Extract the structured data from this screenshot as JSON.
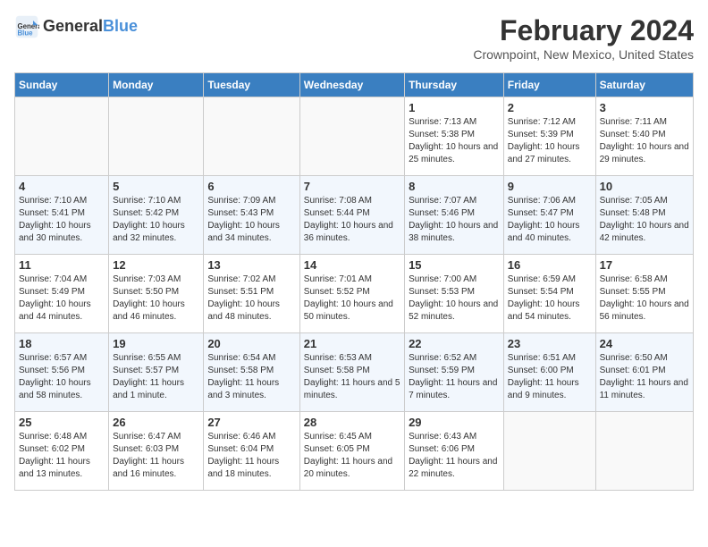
{
  "logo": {
    "line1": "General",
    "line2": "Blue"
  },
  "title": "February 2024",
  "subtitle": "Crownpoint, New Mexico, United States",
  "days_header": [
    "Sunday",
    "Monday",
    "Tuesday",
    "Wednesday",
    "Thursday",
    "Friday",
    "Saturday"
  ],
  "weeks": [
    [
      {
        "num": "",
        "sunrise": "",
        "sunset": "",
        "daylight": ""
      },
      {
        "num": "",
        "sunrise": "",
        "sunset": "",
        "daylight": ""
      },
      {
        "num": "",
        "sunrise": "",
        "sunset": "",
        "daylight": ""
      },
      {
        "num": "",
        "sunrise": "",
        "sunset": "",
        "daylight": ""
      },
      {
        "num": "1",
        "sunrise": "Sunrise: 7:13 AM",
        "sunset": "Sunset: 5:38 PM",
        "daylight": "Daylight: 10 hours and 25 minutes."
      },
      {
        "num": "2",
        "sunrise": "Sunrise: 7:12 AM",
        "sunset": "Sunset: 5:39 PM",
        "daylight": "Daylight: 10 hours and 27 minutes."
      },
      {
        "num": "3",
        "sunrise": "Sunrise: 7:11 AM",
        "sunset": "Sunset: 5:40 PM",
        "daylight": "Daylight: 10 hours and 29 minutes."
      }
    ],
    [
      {
        "num": "4",
        "sunrise": "Sunrise: 7:10 AM",
        "sunset": "Sunset: 5:41 PM",
        "daylight": "Daylight: 10 hours and 30 minutes."
      },
      {
        "num": "5",
        "sunrise": "Sunrise: 7:10 AM",
        "sunset": "Sunset: 5:42 PM",
        "daylight": "Daylight: 10 hours and 32 minutes."
      },
      {
        "num": "6",
        "sunrise": "Sunrise: 7:09 AM",
        "sunset": "Sunset: 5:43 PM",
        "daylight": "Daylight: 10 hours and 34 minutes."
      },
      {
        "num": "7",
        "sunrise": "Sunrise: 7:08 AM",
        "sunset": "Sunset: 5:44 PM",
        "daylight": "Daylight: 10 hours and 36 minutes."
      },
      {
        "num": "8",
        "sunrise": "Sunrise: 7:07 AM",
        "sunset": "Sunset: 5:46 PM",
        "daylight": "Daylight: 10 hours and 38 minutes."
      },
      {
        "num": "9",
        "sunrise": "Sunrise: 7:06 AM",
        "sunset": "Sunset: 5:47 PM",
        "daylight": "Daylight: 10 hours and 40 minutes."
      },
      {
        "num": "10",
        "sunrise": "Sunrise: 7:05 AM",
        "sunset": "Sunset: 5:48 PM",
        "daylight": "Daylight: 10 hours and 42 minutes."
      }
    ],
    [
      {
        "num": "11",
        "sunrise": "Sunrise: 7:04 AM",
        "sunset": "Sunset: 5:49 PM",
        "daylight": "Daylight: 10 hours and 44 minutes."
      },
      {
        "num": "12",
        "sunrise": "Sunrise: 7:03 AM",
        "sunset": "Sunset: 5:50 PM",
        "daylight": "Daylight: 10 hours and 46 minutes."
      },
      {
        "num": "13",
        "sunrise": "Sunrise: 7:02 AM",
        "sunset": "Sunset: 5:51 PM",
        "daylight": "Daylight: 10 hours and 48 minutes."
      },
      {
        "num": "14",
        "sunrise": "Sunrise: 7:01 AM",
        "sunset": "Sunset: 5:52 PM",
        "daylight": "Daylight: 10 hours and 50 minutes."
      },
      {
        "num": "15",
        "sunrise": "Sunrise: 7:00 AM",
        "sunset": "Sunset: 5:53 PM",
        "daylight": "Daylight: 10 hours and 52 minutes."
      },
      {
        "num": "16",
        "sunrise": "Sunrise: 6:59 AM",
        "sunset": "Sunset: 5:54 PM",
        "daylight": "Daylight: 10 hours and 54 minutes."
      },
      {
        "num": "17",
        "sunrise": "Sunrise: 6:58 AM",
        "sunset": "Sunset: 5:55 PM",
        "daylight": "Daylight: 10 hours and 56 minutes."
      }
    ],
    [
      {
        "num": "18",
        "sunrise": "Sunrise: 6:57 AM",
        "sunset": "Sunset: 5:56 PM",
        "daylight": "Daylight: 10 hours and 58 minutes."
      },
      {
        "num": "19",
        "sunrise": "Sunrise: 6:55 AM",
        "sunset": "Sunset: 5:57 PM",
        "daylight": "Daylight: 11 hours and 1 minute."
      },
      {
        "num": "20",
        "sunrise": "Sunrise: 6:54 AM",
        "sunset": "Sunset: 5:58 PM",
        "daylight": "Daylight: 11 hours and 3 minutes."
      },
      {
        "num": "21",
        "sunrise": "Sunrise: 6:53 AM",
        "sunset": "Sunset: 5:58 PM",
        "daylight": "Daylight: 11 hours and 5 minutes."
      },
      {
        "num": "22",
        "sunrise": "Sunrise: 6:52 AM",
        "sunset": "Sunset: 5:59 PM",
        "daylight": "Daylight: 11 hours and 7 minutes."
      },
      {
        "num": "23",
        "sunrise": "Sunrise: 6:51 AM",
        "sunset": "Sunset: 6:00 PM",
        "daylight": "Daylight: 11 hours and 9 minutes."
      },
      {
        "num": "24",
        "sunrise": "Sunrise: 6:50 AM",
        "sunset": "Sunset: 6:01 PM",
        "daylight": "Daylight: 11 hours and 11 minutes."
      }
    ],
    [
      {
        "num": "25",
        "sunrise": "Sunrise: 6:48 AM",
        "sunset": "Sunset: 6:02 PM",
        "daylight": "Daylight: 11 hours and 13 minutes."
      },
      {
        "num": "26",
        "sunrise": "Sunrise: 6:47 AM",
        "sunset": "Sunset: 6:03 PM",
        "daylight": "Daylight: 11 hours and 16 minutes."
      },
      {
        "num": "27",
        "sunrise": "Sunrise: 6:46 AM",
        "sunset": "Sunset: 6:04 PM",
        "daylight": "Daylight: 11 hours and 18 minutes."
      },
      {
        "num": "28",
        "sunrise": "Sunrise: 6:45 AM",
        "sunset": "Sunset: 6:05 PM",
        "daylight": "Daylight: 11 hours and 20 minutes."
      },
      {
        "num": "29",
        "sunrise": "Sunrise: 6:43 AM",
        "sunset": "Sunset: 6:06 PM",
        "daylight": "Daylight: 11 hours and 22 minutes."
      },
      {
        "num": "",
        "sunrise": "",
        "sunset": "",
        "daylight": ""
      },
      {
        "num": "",
        "sunrise": "",
        "sunset": "",
        "daylight": ""
      }
    ]
  ]
}
